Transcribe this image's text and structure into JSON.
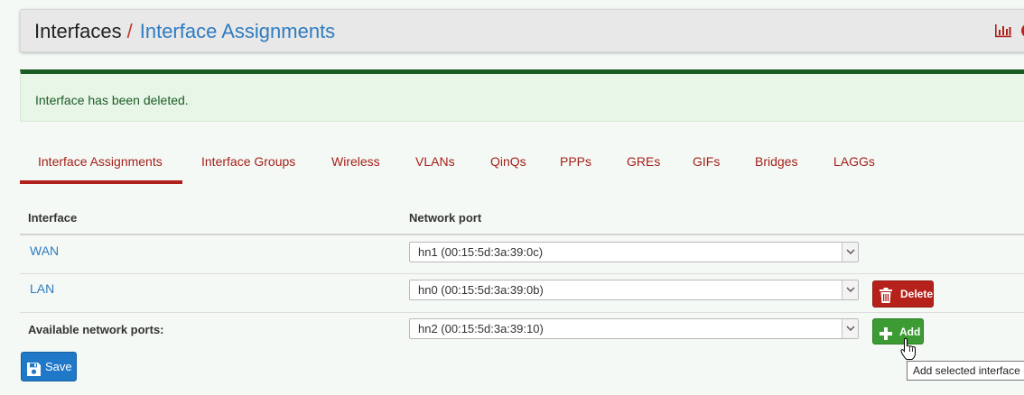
{
  "breadcrumb": {
    "root": "Interfaces",
    "separator": "/",
    "current": "Interface Assignments"
  },
  "header_icons": [
    "bar-chart-icon",
    "help-icon"
  ],
  "alert": {
    "message": "Interface has been deleted."
  },
  "tabs": [
    {
      "label": "Interface Assignments",
      "active": true
    },
    {
      "label": "Interface Groups"
    },
    {
      "label": "Wireless"
    },
    {
      "label": "VLANs"
    },
    {
      "label": "QinQs"
    },
    {
      "label": "PPPs"
    },
    {
      "label": "GREs"
    },
    {
      "label": "GIFs"
    },
    {
      "label": "Bridges"
    },
    {
      "label": "LAGGs"
    }
  ],
  "table": {
    "headers": {
      "interface": "Interface",
      "network_port": "Network port"
    },
    "rows": [
      {
        "interface": "WAN",
        "port": "hn1 (00:15:5d:3a:39:0c)"
      },
      {
        "interface": "LAN",
        "port": "hn0 (00:15:5d:3a:39:0b)",
        "action": "Delete"
      }
    ],
    "available": {
      "label": "Available network ports:",
      "port": "hn2 (00:15:5d:3a:39:10)",
      "action": "Add"
    }
  },
  "save_label": "Save",
  "tooltip": "Add selected interface",
  "colors": {
    "link": "#2f7cc1",
    "tab": "#a4201a",
    "delete": "#b6211b",
    "add": "#3c9b33",
    "save": "#1f78c8",
    "alert_bg": "#e8f6e8"
  }
}
